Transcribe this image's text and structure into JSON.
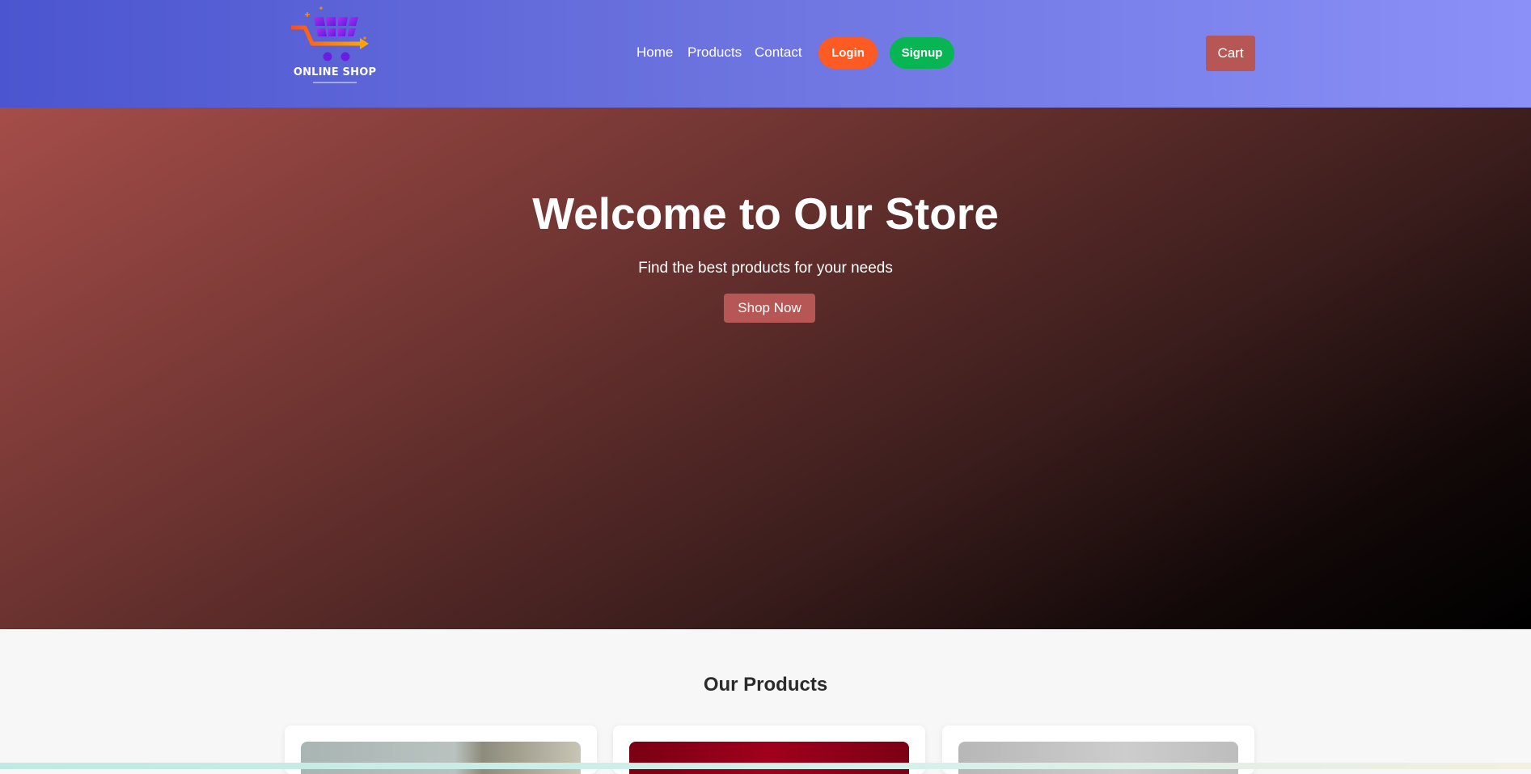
{
  "header": {
    "logo_text": "ONLINE SHOP",
    "nav": {
      "home": "Home",
      "products": "Products",
      "contact": "Contact"
    },
    "login_label": "Login",
    "signup_label": "Signup",
    "cart_label": "Cart"
  },
  "hero": {
    "title": "Welcome to Our Store",
    "subtitle": "Find the best products for your needs",
    "cta_label": "Shop Now"
  },
  "products": {
    "title": "Our Products"
  },
  "colors": {
    "login": "#fe5a23",
    "signup": "#07b553",
    "accent": "#b65756",
    "header_start": "#4b55cf",
    "header_end": "#8a90f7"
  },
  "icons": {
    "logo": "shopping-cart-logo-icon"
  }
}
